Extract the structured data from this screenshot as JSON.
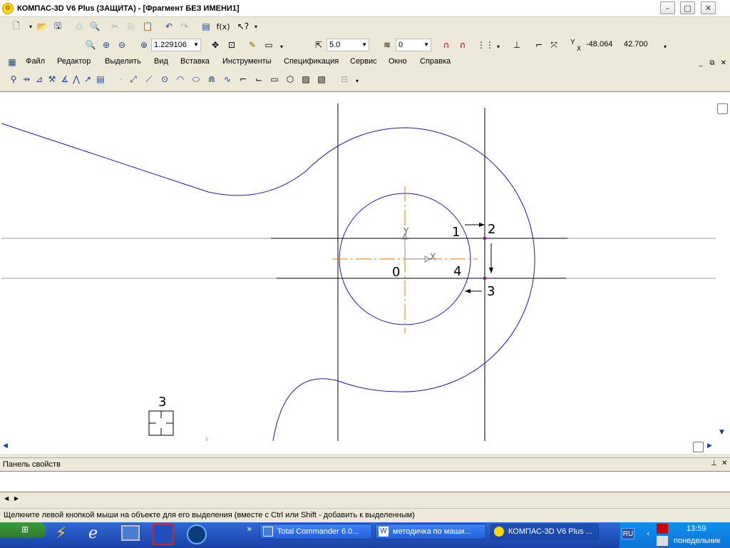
{
  "window": {
    "title": "КОМПАС-3D V6 Plus (ЗАЩИТА) - [Фрагмент БЕЗ ИМЕНИ1]",
    "minimize": "–",
    "maximize": "□",
    "close": "✕"
  },
  "toolbar": {
    "zoom_value": "1.229106",
    "step_value": "5.0",
    "layer_value": "0",
    "coord_x_label": "Y",
    "coord_y_sub": "X",
    "coord_x": "-48.064",
    "coord_y": "42.700",
    "fx_label": "f(x)"
  },
  "menu": {
    "items": [
      "Файл",
      "Редактор",
      "Выделить",
      "Вид",
      "Вставка",
      "Инструменты",
      "Спецификация",
      "Сервис",
      "Окно",
      "Справка"
    ]
  },
  "drawing": {
    "labels": {
      "p1": "1",
      "p2": "2",
      "p3": "3",
      "p4": "4",
      "p0": "0",
      "axis_y": "Y",
      "axis_x": "X",
      "snap_number": "3"
    }
  },
  "panel": {
    "title": "Панель свойств",
    "pin": "⊥",
    "close": "✕"
  },
  "status": {
    "text": "Щелкните левой кнопкой мыши на объекте для его выделения (вместе с Ctrl или Shift - добавить к выделенным)"
  },
  "taskbar": {
    "expand": "»",
    "tasks": [
      {
        "label": "Total Commander 6.0..."
      },
      {
        "label": "методичка по маши..."
      },
      {
        "label": "КОМПАС-3D V6 Plus ..."
      }
    ],
    "lang": "RU",
    "time": "13:59",
    "day": "понедельник"
  },
  "colors": {
    "geometry": "#1c1ca8",
    "axis": "#e07a10",
    "line": "#000000",
    "snap_marker": "#c000c0"
  }
}
